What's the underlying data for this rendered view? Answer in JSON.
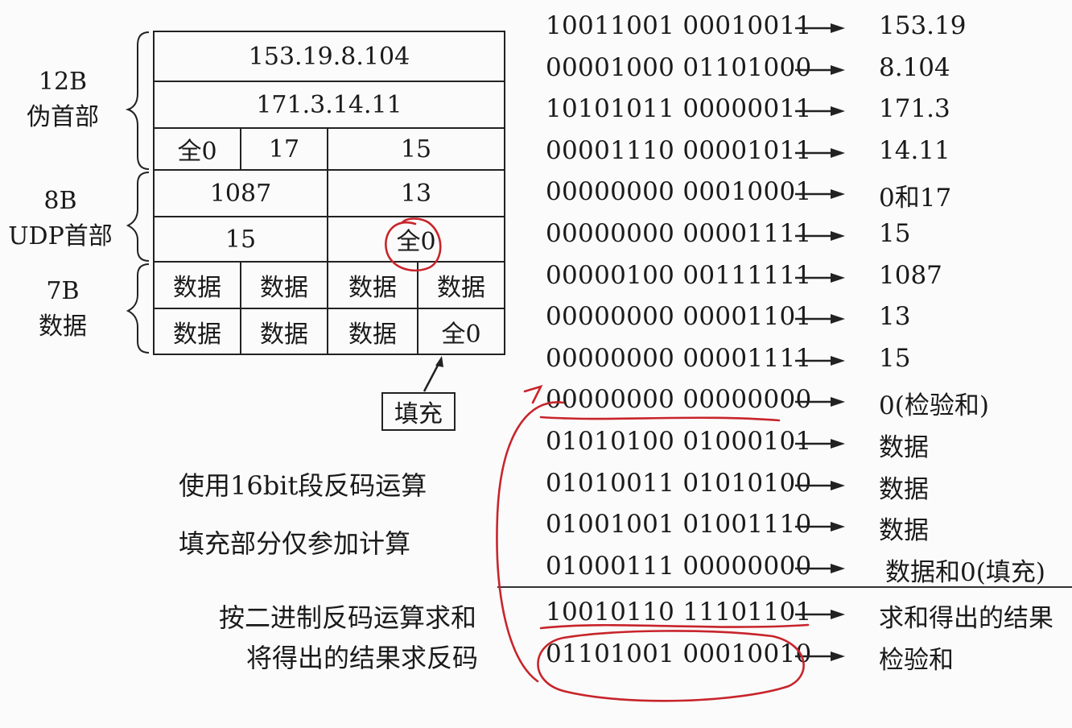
{
  "left_labels": [
    {
      "size": "12B",
      "name": "伪首部"
    },
    {
      "size": "8B",
      "name": "UDP首部"
    },
    {
      "size": "7B",
      "name": "数据"
    }
  ],
  "table": {
    "src_ip": "153.19.8.104",
    "dst_ip": "171.3.14.11",
    "zero": "全0",
    "protocol": "17",
    "udp_length": "15",
    "src_port": "1087",
    "dst_port": "13",
    "length": "15",
    "checksum": "全0",
    "data_cell": "数据",
    "pad": "全0"
  },
  "fill_label": "填充",
  "notes": [
    "使用16bit段反码运算",
    "填充部分仅参加计算"
  ],
  "ops": [
    "按二进制反码运算求和",
    "将得出的结果求反码"
  ],
  "rows": [
    {
      "bits": "10011001 00010011",
      "value": "153.19"
    },
    {
      "bits": "00001000 01101000",
      "value": "8.104"
    },
    {
      "bits": "10101011 00000011",
      "value": "171.3"
    },
    {
      "bits": "00001110 00001011",
      "value": "14.11"
    },
    {
      "bits": "00000000 00010001",
      "value": "0和17"
    },
    {
      "bits": "00000000 00001111",
      "value": "15"
    },
    {
      "bits": "00000100 00111111",
      "value": "1087"
    },
    {
      "bits": "00000000 00001101",
      "value": "13"
    },
    {
      "bits": "00000000 00001111",
      "value": "15"
    },
    {
      "bits": "00000000 00000000",
      "value": "0(检验和)"
    },
    {
      "bits": "01010100 01000101",
      "value": "数据"
    },
    {
      "bits": "01010011 01010100",
      "value": "数据"
    },
    {
      "bits": "01001001 01001110",
      "value": "数据"
    },
    {
      "bits": "01000111 00000000",
      "value": "数据和0(填充)"
    }
  ],
  "sum_row": {
    "bits": "10010110 11101101",
    "value": "求和得出的结果"
  },
  "checksum_row": {
    "bits": "01101001 00010010",
    "value": "检验和"
  },
  "colors": {
    "ink": "#1a1a1a",
    "annotation": "#c8242b",
    "background": "#fbfbfb"
  }
}
